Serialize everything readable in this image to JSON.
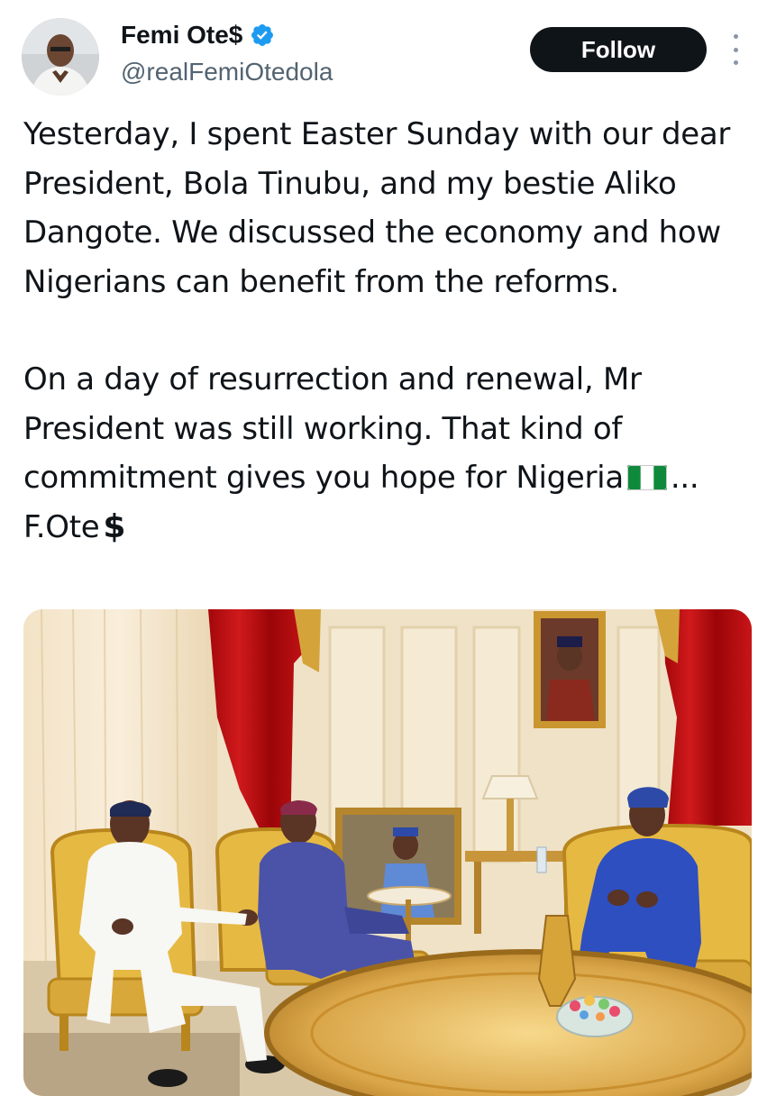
{
  "tweet": {
    "author": {
      "display_name": "Femi Ote$",
      "handle": "@realFemiOtedola",
      "verified": true,
      "verified_icon": "verified-badge-icon",
      "verified_color": "#1d9bf0"
    },
    "follow_label": "Follow",
    "more_icon": "more-vertical-icon",
    "paragraph_1": "Yesterday, I spent Easter Sunday with our dear President, Bola Tinubu, and my bestie Aliko Dangote. We discussed the economy and how Nigerians can benefit from the reforms.",
    "paragraph_2": "On a day of resurrection and renewal, Mr President was still working. That kind of commitment gives you hope for Nigeria",
    "paragraph_2_flag_icon": "nigeria-flag-icon",
    "paragraph_2_ellipsis": "...",
    "signature_text": "F.Ote",
    "signature_symbol": "$"
  },
  "colors": {
    "text": "#0f1419",
    "secondary": "#536471",
    "follow_bg": "#0f1419",
    "follow_text": "#ffffff"
  }
}
